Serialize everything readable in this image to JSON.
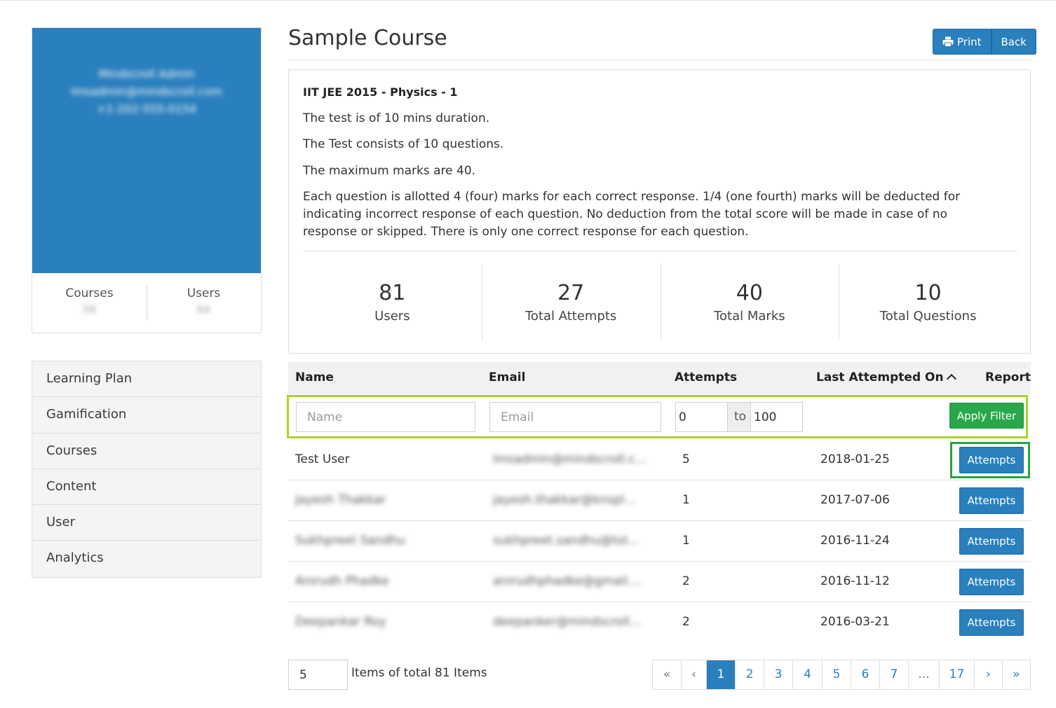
{
  "profile": {
    "name": "Mindscroll Admin",
    "email": "lmsadmin@mindscroll.com",
    "phone": "+1-202-555-0154",
    "stats": [
      {
        "label": "Courses",
        "value": "59"
      },
      {
        "label": "Users",
        "value": "64"
      }
    ]
  },
  "sidebar": {
    "items": [
      {
        "label": "Learning Plan"
      },
      {
        "label": "Gamification"
      },
      {
        "label": "Courses"
      },
      {
        "label": "Content"
      },
      {
        "label": "User"
      },
      {
        "label": "Analytics"
      }
    ]
  },
  "header": {
    "title": "Sample Course",
    "print_label": "Print",
    "back_label": "Back"
  },
  "test_info": {
    "name": "IIT JEE 2015 - Physics - 1",
    "lines": [
      "The test is of 10 mins duration.",
      "The Test consists of 10 questions.",
      "The maximum marks are 40.",
      "Each question is allotted 4 (four) marks for each correct response. 1/4 (one fourth) marks will be deducted for indicating incorrect response of each question. No deduction from the total score will be made in case of no response or skipped. There is only one correct response for each question."
    ],
    "stats": [
      {
        "value": "81",
        "label": "Users"
      },
      {
        "value": "27",
        "label": "Total Attempts"
      },
      {
        "value": "40",
        "label": "Total Marks"
      },
      {
        "value": "10",
        "label": "Total Questions"
      }
    ]
  },
  "table": {
    "columns": {
      "name": "Name",
      "email": "Email",
      "attempts": "Attempts",
      "last_attempted": "Last Attempted On",
      "report": "Report"
    },
    "filter": {
      "name_placeholder": "Name",
      "email_placeholder": "Email",
      "min_value": "0",
      "to_label": "to",
      "max_value": "100",
      "apply_label": "Apply Filter"
    },
    "rows": [
      {
        "name": "Test User",
        "email": "lmsadmin@mindscroll.c...",
        "attempts": "5",
        "last": "2018-01-25",
        "action": "Attempts"
      },
      {
        "name": "Jayesh Thakkar",
        "email": "jayesh.thakkar@knspl...",
        "attempts": "1",
        "last": "2017-07-06",
        "action": "Attempts"
      },
      {
        "name": "Sukhpreet Sandhu",
        "email": "sukhpreet.sandhu@tol...",
        "attempts": "1",
        "last": "2016-11-24",
        "action": "Attempts"
      },
      {
        "name": "Anirudh Phadke",
        "email": "anirudhphadke@gmail....",
        "attempts": "2",
        "last": "2016-11-12",
        "action": "Attempts"
      },
      {
        "name": "Deepankar Roy",
        "email": "deepanker@mindscroll...",
        "attempts": "2",
        "last": "2016-03-21",
        "action": "Attempts"
      }
    ]
  },
  "footer": {
    "page_size": "5",
    "items_text": "Items of total 81 Items",
    "pages": [
      "«",
      "‹",
      "1",
      "2",
      "3",
      "4",
      "5",
      "6",
      "7",
      "...",
      "17",
      "›",
      "»"
    ],
    "active_page": "1"
  },
  "colors": {
    "primary": "#2a7fbd",
    "success": "#28a84a",
    "filter_highlight": "#a6d32d",
    "attempt_highlight": "#27a53f"
  }
}
